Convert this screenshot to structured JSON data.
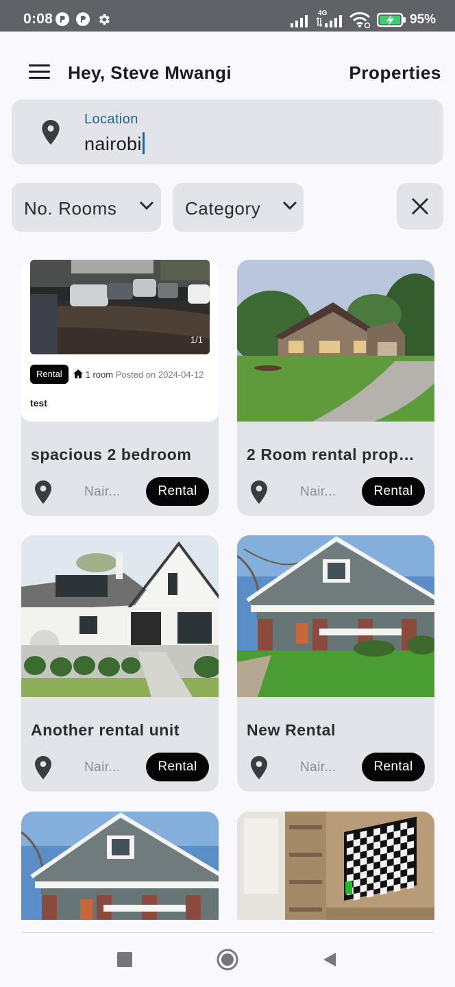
{
  "status_bar": {
    "time": "0:08",
    "battery_percent": "95%",
    "network_label": "4G",
    "icons": [
      "notification-p-icon",
      "notification-p-icon",
      "gear-icon",
      "signal-icon",
      "signal-4g-icon",
      "wifi-icon",
      "battery-charging-icon"
    ]
  },
  "header": {
    "menu_icon": "hamburger-menu-icon",
    "greeting": "Hey, Steve Mwangi",
    "title": "Properties"
  },
  "search": {
    "icon": "location-pin-icon",
    "label": "Location",
    "value": "nairobi"
  },
  "filters": {
    "rooms_label": "No. Rooms",
    "category_label": "Category",
    "clear_icon": "close-icon"
  },
  "listings": [
    {
      "title": "spacious 2 bedroom",
      "location": "Nair...",
      "tag": "Rental",
      "preview": {
        "image_counter": "1/1",
        "tag": "Rental",
        "rooms": "1 room",
        "posted": "Posted on 2024-04-12",
        "description": "test"
      }
    },
    {
      "title": "2 Room rental prop…",
      "location": "Nair...",
      "tag": "Rental"
    },
    {
      "title": "Another rental unit",
      "location": "Nair...",
      "tag": "Rental"
    },
    {
      "title": "New Rental",
      "location": "Nair...",
      "tag": "Rental"
    },
    {
      "title": "",
      "location": "",
      "tag": ""
    },
    {
      "title": "",
      "location": "",
      "tag": ""
    }
  ],
  "nav": {
    "recents_icon": "square-recents-icon",
    "home_icon": "circle-home-icon",
    "back_icon": "triangle-back-icon"
  },
  "colors": {
    "accent": "#1f6596",
    "chip": "#050505",
    "surface": "#e2e4ea",
    "status_bar": "#5f6266"
  }
}
